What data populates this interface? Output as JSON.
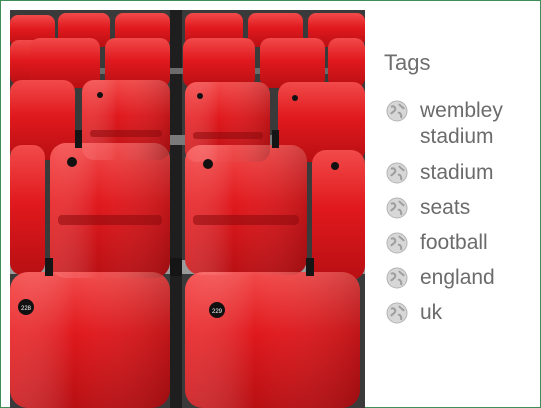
{
  "photo": {
    "alt": "",
    "seat_numbers": [
      "228",
      "229"
    ]
  },
  "tags": {
    "title": "Tags",
    "items": [
      {
        "label": "wembley stadium"
      },
      {
        "label": "stadium"
      },
      {
        "label": "seats"
      },
      {
        "label": "football"
      },
      {
        "label": "england"
      },
      {
        "label": "uk"
      }
    ]
  },
  "colors": {
    "seat_red": "#e21e22",
    "frame_border": "#3e8f57",
    "tag_text": "#6b6b6b"
  }
}
